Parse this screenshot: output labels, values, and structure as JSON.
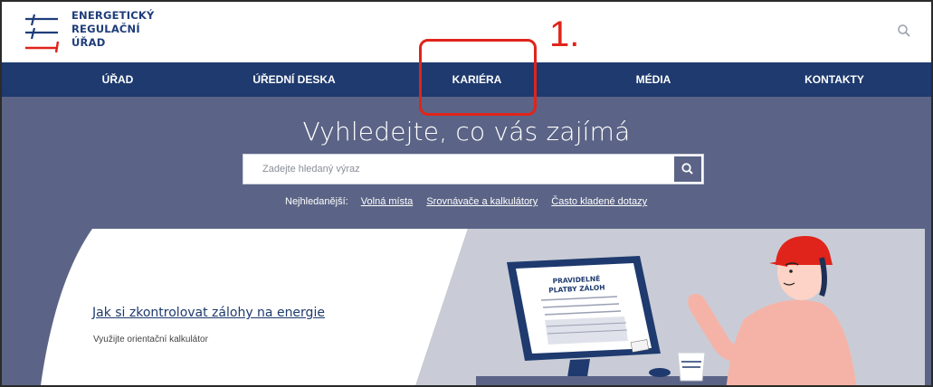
{
  "header": {
    "logo_lines": [
      "ENERGETICKÝ",
      "REGULAČNÍ",
      "ÚŘAD"
    ],
    "search_icon": "search-icon"
  },
  "nav": {
    "items": [
      {
        "label": "ÚŘAD"
      },
      {
        "label": "ÚŘEDNÍ DESKA"
      },
      {
        "label": "KARIÉRA"
      },
      {
        "label": "MÉDIA"
      },
      {
        "label": "KONTAKTY"
      }
    ]
  },
  "annotation": {
    "number": "1.",
    "color": "#e0241b"
  },
  "hero": {
    "title": "Vyhledejte, co vás zajímá",
    "search": {
      "placeholder": "Zadejte hledaný výraz",
      "value": "",
      "icon": "search-icon"
    },
    "popular_label": "Nejhledanější:",
    "popular_links": [
      "Volná místa",
      "Srovnávače a kalkulátory",
      "Často kladené dotazy"
    ]
  },
  "card": {
    "link": "Jak si zkontrolovat zálohy na energie",
    "subtitle": "Využijte orientační kalkulátor",
    "screen_text_1": "PRAVIDELNÉ",
    "screen_text_2": "PLATBY ZÁLOH"
  },
  "colors": {
    "brand_blue": "#1e3a6e",
    "hero_bg": "#5b6486",
    "accent_red": "#e0241b",
    "card_illustration_bg": "#c9ccd6"
  }
}
